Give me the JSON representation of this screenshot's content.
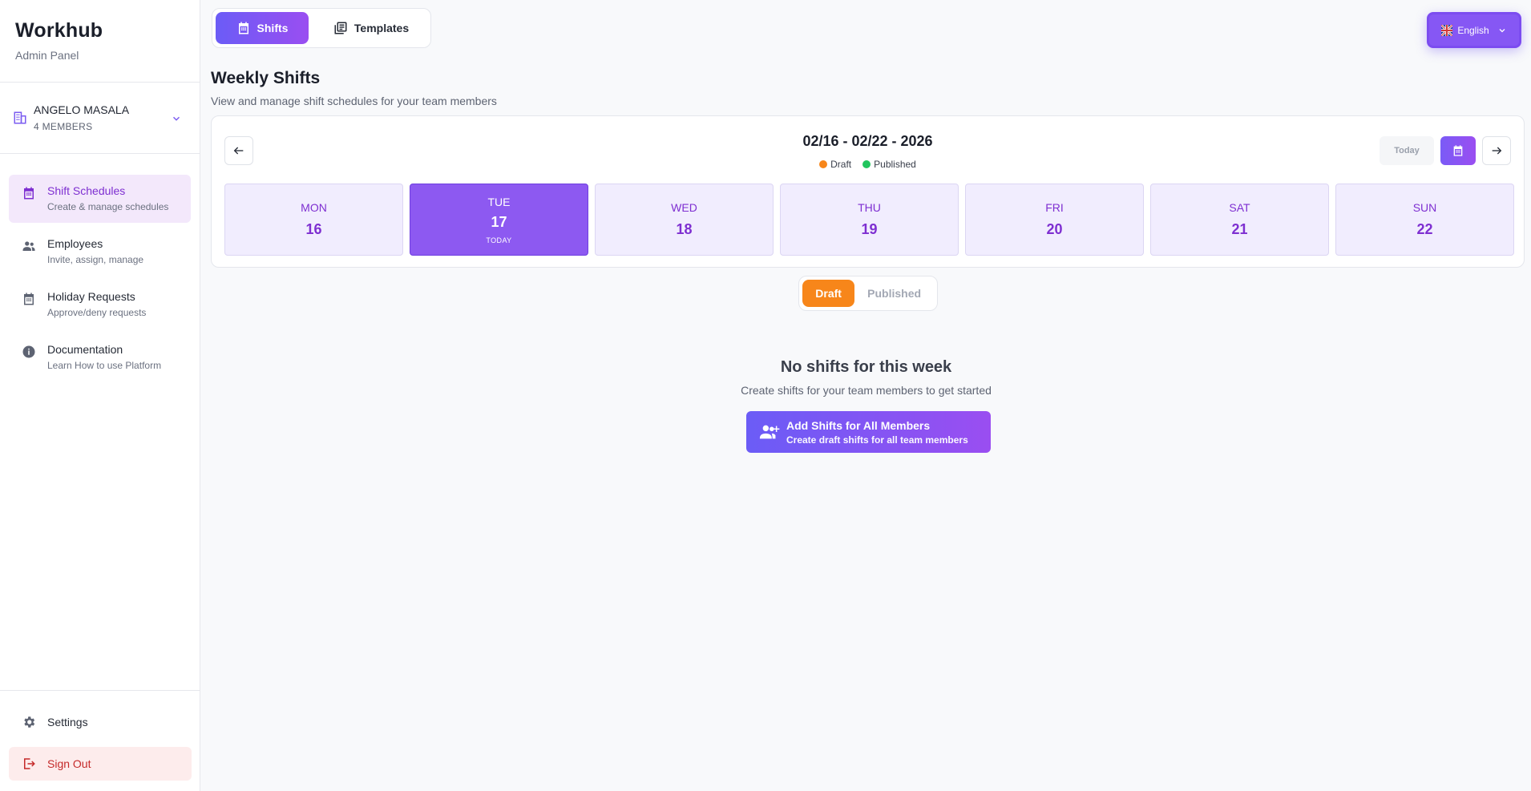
{
  "sidebar": {
    "brand_title": "Workhub",
    "brand_sub": "Admin Panel",
    "org": {
      "name": "ANGELO MASALA",
      "members": "4 MEMBERS",
      "icon": "building-icon"
    },
    "items": [
      {
        "label": "Shift Schedules",
        "desc": "Create & manage schedules",
        "icon": "calendar-icon",
        "active": true
      },
      {
        "label": "Employees",
        "desc": "Invite, assign, manage",
        "icon": "people-icon",
        "active": false
      },
      {
        "label": "Holiday Requests",
        "desc": "Approve/deny requests",
        "icon": "calendar-icon",
        "active": false
      },
      {
        "label": "Documentation",
        "desc": "Learn How to use Platform",
        "icon": "info-icon",
        "active": false
      }
    ],
    "settings_label": "Settings",
    "signout_label": "Sign Out"
  },
  "header": {
    "tabs": [
      {
        "label": "Shifts",
        "icon": "calendar-icon",
        "active": true
      },
      {
        "label": "Templates",
        "icon": "templates-icon",
        "active": false
      }
    ],
    "language": "English"
  },
  "page": {
    "title": "Weekly Shifts",
    "subtitle": "View and manage shift schedules for your team members"
  },
  "week": {
    "range": "02/16 - 02/22 - 2026",
    "legend": [
      {
        "label": "Draft",
        "color": "#f7861a"
      },
      {
        "label": "Published",
        "color": "#22c55e"
      }
    ],
    "today_button": "Today",
    "days": [
      {
        "name": "MON",
        "num": "16",
        "today": false
      },
      {
        "name": "TUE",
        "num": "17",
        "today": true,
        "today_label": "TODAY"
      },
      {
        "name": "WED",
        "num": "18",
        "today": false
      },
      {
        "name": "THU",
        "num": "19",
        "today": false
      },
      {
        "name": "FRI",
        "num": "20",
        "today": false
      },
      {
        "name": "SAT",
        "num": "21",
        "today": false
      },
      {
        "name": "SUN",
        "num": "22",
        "today": false
      }
    ]
  },
  "status_toggle": {
    "draft": "Draft",
    "published": "Published",
    "selected": "Draft"
  },
  "empty_state": {
    "title": "No shifts for this week",
    "subtitle": "Create shifts for your team members to get started",
    "button_title": "Add Shifts for All Members",
    "button_desc": "Create draft shifts for all team members"
  },
  "colors": {
    "accent": "#8657f4",
    "active_nav_bg": "#f3e8fb",
    "draft": "#f7861a",
    "published": "#22c55e",
    "signout_bg": "#fdecec"
  }
}
